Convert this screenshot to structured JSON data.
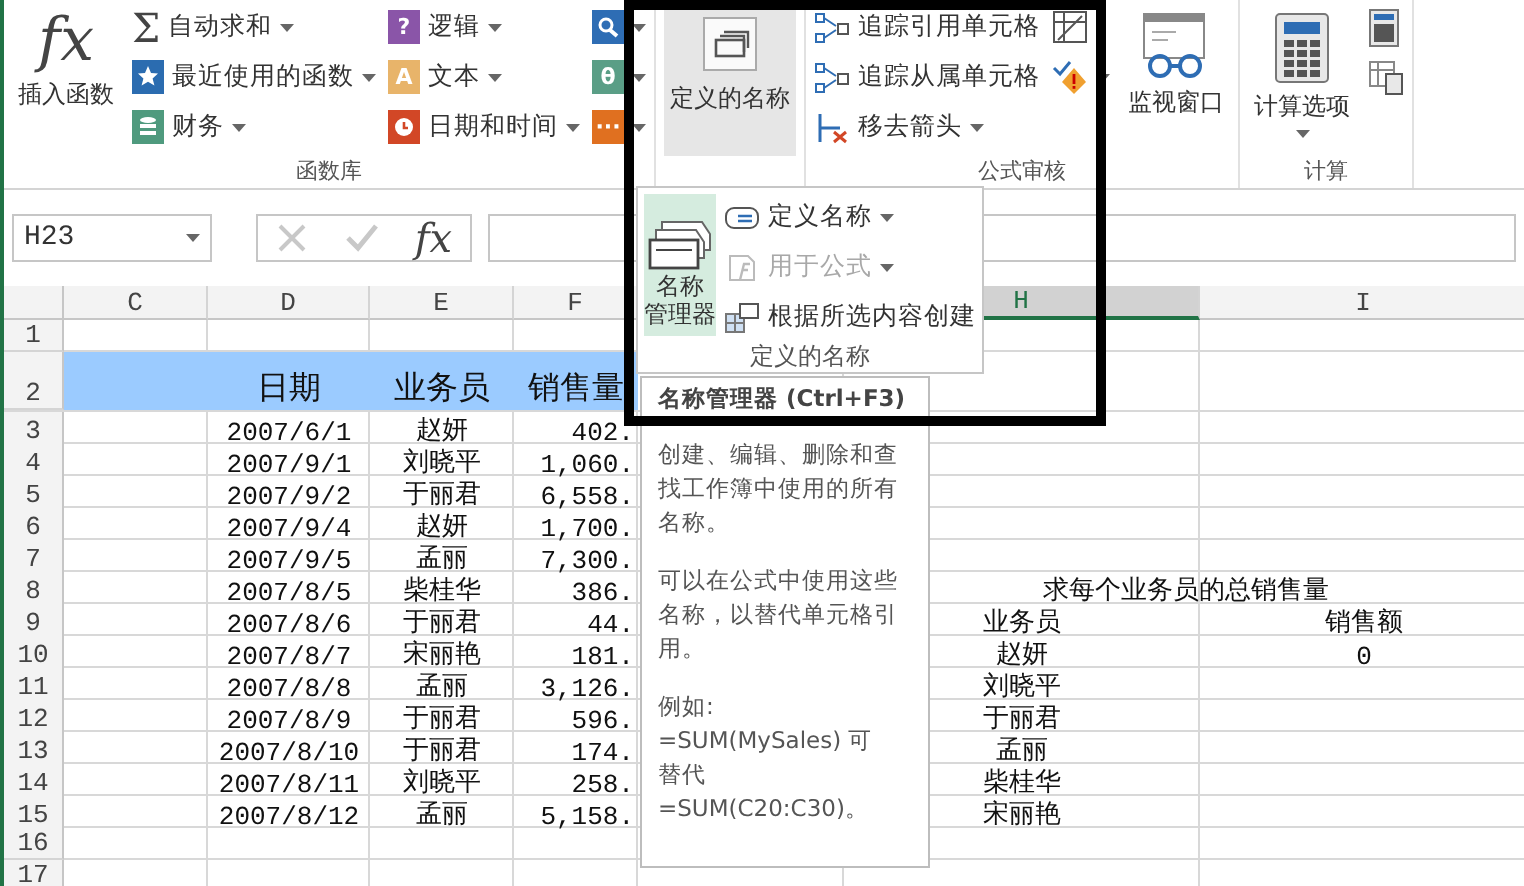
{
  "ribbon": {
    "groups": [
      {
        "label": "函数库",
        "big": [
          {
            "label": "插入函数",
            "kind": "glyph",
            "glyph": "fx",
            "pressed": false
          }
        ],
        "columns": [
          [
            {
              "label": "自动求和",
              "kind": "glyph",
              "glyph": "Σ",
              "dropdown": true
            },
            {
              "label": "最近使用的函数",
              "kind": "star",
              "color": "#2b6cb0",
              "dropdown": true
            },
            {
              "label": "财务",
              "kind": "db",
              "color": "#4f9a7e",
              "dropdown": true
            }
          ],
          [
            {
              "label": "逻辑",
              "kind": "book",
              "glyph": "?",
              "color": "#8a55a8",
              "dropdown": true
            },
            {
              "label": "文本",
              "kind": "book",
              "glyph": "A",
              "color": "#e8b46a",
              "dropdown": true
            },
            {
              "label": "日期和时间",
              "kind": "clock",
              "color": "#d24726",
              "dropdown": true
            }
          ],
          [
            {
              "kind": "search",
              "color": "#2e6db4",
              "dropdown": true
            },
            {
              "kind": "book",
              "glyph": "θ",
              "color": "#5a9e86",
              "dropdown": true
            },
            {
              "kind": "book",
              "glyph": "···",
              "color": "#e07020",
              "dropdown": true
            }
          ]
        ]
      },
      {
        "big": [
          {
            "label": "定义的名称",
            "kind": "tag",
            "pressed": true
          }
        ]
      },
      {
        "label": "公式审核",
        "columns": [
          [
            {
              "label": "追踪引用单元格",
              "kind": "trace",
              "dropdown": false
            },
            {
              "label": "追踪从属单元格",
              "kind": "trace",
              "dropdown": false
            },
            {
              "label": "移去箭头",
              "kind": "remove",
              "dropdown": true
            }
          ],
          [
            {
              "kind": "sheet",
              "dropdown": false
            },
            {
              "kind": "warn",
              "dropdown": true
            }
          ]
        ],
        "after": [
          {
            "label": "监视窗口",
            "kind": "glasses",
            "pressed": false
          }
        ]
      },
      {
        "label": "计算",
        "big": [
          {
            "label": "计算选项",
            "kind": "calc",
            "pressed": false,
            "dropdown": true
          }
        ],
        "columns": [
          [
            {
              "kind": "calcsmall",
              "dropdown": false
            },
            {
              "kind": "calcsheet",
              "dropdown": false
            }
          ]
        ]
      }
    ]
  },
  "formula_bar": {
    "name_box": "H23",
    "fx": "fx"
  },
  "columns": [
    {
      "letter": "C",
      "selected": false
    },
    {
      "letter": "D",
      "selected": false
    },
    {
      "letter": "E",
      "selected": false
    },
    {
      "letter": "F",
      "selected": false
    },
    {
      "letter": "H",
      "selected": true
    },
    {
      "letter": "I",
      "selected": false
    }
  ],
  "rows": [
    {
      "number": "1"
    },
    {
      "number": "2",
      "kind": "header",
      "date": "日期",
      "salesperson": "业务员",
      "amount": "销售量"
    },
    {
      "number": "3",
      "date": "2007/6/1",
      "salesperson": "赵妍",
      "amount": "402."
    },
    {
      "number": "4",
      "date": "2007/9/1",
      "salesperson": "刘晓平",
      "amount": "1,060."
    },
    {
      "number": "5",
      "date": "2007/9/2",
      "salesperson": "于丽君",
      "amount": "6,558."
    },
    {
      "number": "6",
      "date": "2007/9/4",
      "salesperson": "赵妍",
      "amount": "1,700."
    },
    {
      "number": "7",
      "date": "2007/9/5",
      "salesperson": "孟丽",
      "amount": "7,300."
    },
    {
      "number": "8",
      "date": "2007/8/5",
      "salesperson": "柴桂华",
      "amount": "386.",
      "summary_title": "求每个业务员的总销售量"
    },
    {
      "number": "9",
      "date": "2007/8/6",
      "salesperson": "于丽君",
      "amount": "44.",
      "summary_name": "业务员",
      "summary_total": "销售额"
    },
    {
      "number": "10",
      "date": "2007/8/7",
      "salesperson": "宋丽艳",
      "amount": "181.",
      "summary_name": "赵妍",
      "summary_total": "0"
    },
    {
      "number": "11",
      "date": "2007/8/8",
      "salesperson": "孟丽",
      "amount": "3,126.",
      "summary_name": "刘晓平"
    },
    {
      "number": "12",
      "date": "2007/8/9",
      "salesperson": "于丽君",
      "amount": "596.",
      "summary_name": "于丽君"
    },
    {
      "number": "13",
      "date": "2007/8/10",
      "salesperson": "于丽君",
      "amount": "174.",
      "summary_name": "孟丽"
    },
    {
      "number": "14",
      "date": "2007/8/11",
      "salesperson": "刘晓平",
      "amount": "258.",
      "summary_name": "柴桂华"
    },
    {
      "number": "15",
      "date": "2007/8/12",
      "salesperson": "孟丽",
      "amount": "5,158.",
      "summary_name": "宋丽艳"
    },
    {
      "number": "16"
    },
    {
      "number": "17"
    }
  ],
  "names_menu": {
    "big_lines": [
      "名称",
      "管理器"
    ],
    "items": [
      {
        "label": "定义名称",
        "kind": "define",
        "dropdown": true,
        "disabled": false
      },
      {
        "label": "用于公式",
        "kind": "use",
        "dropdown": true,
        "disabled": true
      },
      {
        "label": "根据所选内容创建",
        "kind": "create",
        "dropdown": false,
        "disabled": false
      }
    ],
    "label": "定义的名称"
  },
  "tooltip": {
    "title": "名称管理器 (Ctrl+F3)",
    "paragraphs": [
      [
        "创建、编辑、删除和查",
        "找工作簿中使用的所有",
        "名称。"
      ],
      [
        "可以在公式中使用这些",
        "名称，以替代单元格引",
        "用。"
      ],
      [
        "例如:",
        "=SUM(MySales) 可",
        "替代",
        "=SUM(C20:C30)。"
      ]
    ]
  }
}
